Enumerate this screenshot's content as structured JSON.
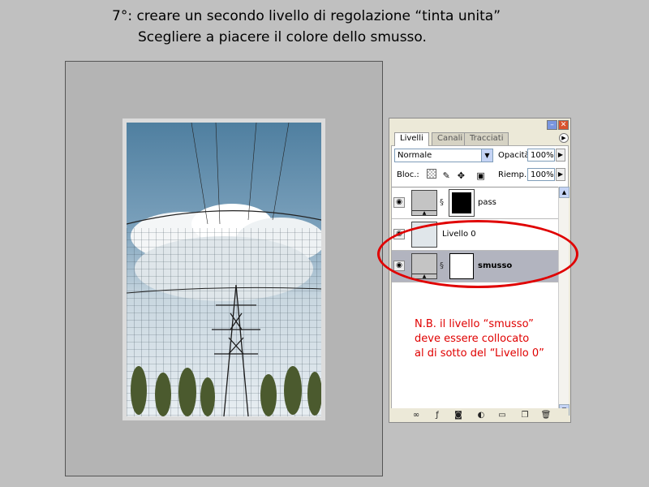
{
  "caption": {
    "line1": "7°: creare un secondo livello di regolazione “tinta unita”",
    "line2": "Scegliere a piacere il colore dello smusso."
  },
  "panel": {
    "tabs": [
      {
        "label": "Livelli",
        "active": true
      },
      {
        "label": "Canali",
        "active": false
      },
      {
        "label": "Tracciati",
        "active": false
      }
    ],
    "blend_mode": "Normale",
    "opacity_label": "Opacità:",
    "opacity_value": "100%",
    "lock_label": "Bloc.:",
    "fill_label": "Riemp.:",
    "fill_value": "100%",
    "layers": [
      {
        "name": "pass",
        "visible": true,
        "selected": false,
        "mask": "black"
      },
      {
        "name": "Livello 0",
        "visible": true,
        "selected": false,
        "mask": "none"
      },
      {
        "name": "smusso",
        "visible": true,
        "selected": true,
        "mask": "white"
      }
    ],
    "bottom_icons": [
      "link-icon",
      "layer-style-icon",
      "mask-icon",
      "adjustment-icon",
      "folder-icon",
      "new-layer-icon",
      "trash-icon"
    ]
  },
  "note": {
    "line1": "N.B. il  livello “smusso”",
    "line2": "deve essere collocato",
    "line3": "al di sotto del “Livello 0”"
  },
  "colors": {
    "annotation": "#e00000",
    "selected_layer": "#b2b4bf",
    "sky": "#6d92ad"
  }
}
